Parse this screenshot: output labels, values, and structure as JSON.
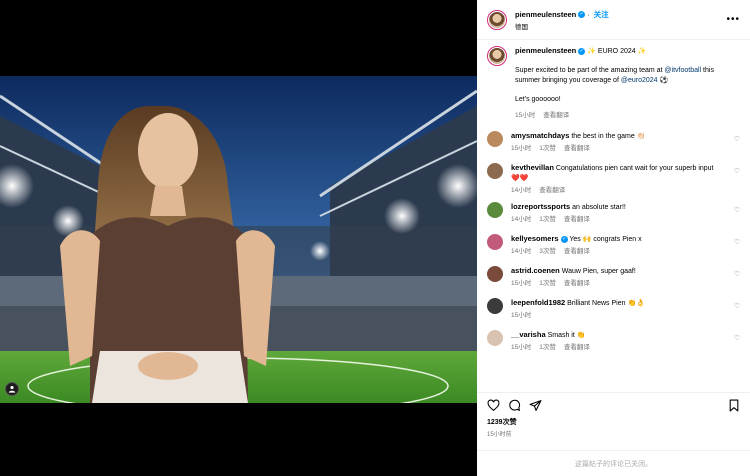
{
  "post_author": {
    "username": "pienmeulensteen",
    "follow_label": "关注",
    "location": "德国"
  },
  "caption": {
    "username": "pienmeulensteen",
    "headline": "✨ EURO 2024 ✨",
    "text_part1": "Super excited to be part of the amazing team at ",
    "mention1": "@itvfootball",
    "text_part2": " this summer bringing you coverage of ",
    "mention2": "@euro2024",
    "emoji": " ⚽",
    "line2": "Let's goooooo!",
    "time": "15小时",
    "translate": "查看翻译"
  },
  "comments": [
    {
      "username": "amysmatchdays",
      "verified": false,
      "text": "the best in the game 👏🏻",
      "time": "15小时",
      "likes": "1次赞",
      "translate": "查看翻译",
      "avatar_color": "#b98a5e"
    },
    {
      "username": "kevthevillan",
      "verified": false,
      "text": "Congatulations pien cant wait for your superb input ❤️❤️",
      "time": "14小时",
      "likes": "",
      "translate": "查看翻译",
      "avatar_color": "#8c6a4f"
    },
    {
      "username": "lozreportssports",
      "verified": false,
      "text": "an absolute star!!",
      "time": "14小时",
      "likes": "1次赞",
      "translate": "查看翻译",
      "avatar_color": "#5a8a3c"
    },
    {
      "username": "kellyesomers",
      "verified": true,
      "text": "Yes 🙌 congrats Pien x",
      "time": "14小时",
      "likes": "3次赞",
      "translate": "查看翻译",
      "avatar_color": "#c25b7a"
    },
    {
      "username": "astrid.coenen",
      "verified": false,
      "text": "Wauw Pien, super gaaf!",
      "time": "15小时",
      "likes": "1次赞",
      "translate": "查看翻译",
      "avatar_color": "#7a4b3a"
    },
    {
      "username": "leepenfold1982",
      "verified": false,
      "text": "Brilliant News Pien 👏👌",
      "time": "15小时",
      "likes": "",
      "translate": "",
      "avatar_color": "#3b3b3b"
    },
    {
      "username": "__varisha",
      "verified": false,
      "text": "Smash it 👏",
      "time": "15小时",
      "likes": "1次赞",
      "translate": "查看翻译",
      "avatar_color": "#d9c2b0"
    }
  ],
  "engagement": {
    "likes": "1239次赞",
    "time": "15小时前",
    "comments_closed": "这篇帖子的评论已关闭。"
  },
  "icons": {
    "like": "heart-icon",
    "comment": "comment-icon",
    "share": "share-icon",
    "save": "bookmark-icon",
    "tag": "user-tag-icon",
    "more": "more-options-icon"
  }
}
